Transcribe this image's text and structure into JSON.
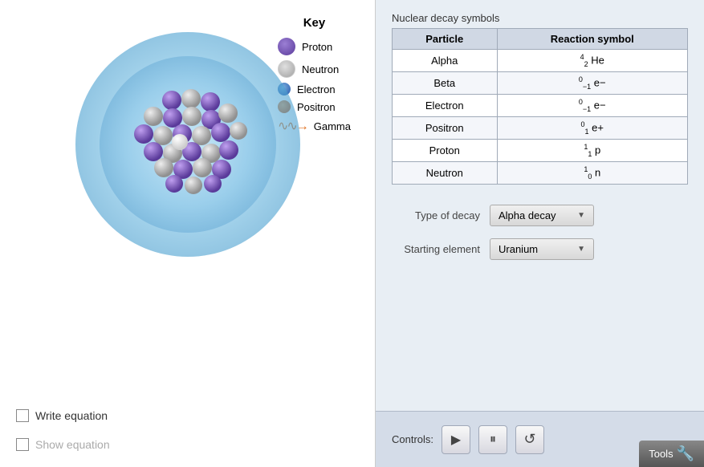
{
  "left": {
    "key": {
      "title": "Key",
      "items": [
        {
          "id": "proton",
          "label": "Proton"
        },
        {
          "id": "neutron",
          "label": "Neutron"
        },
        {
          "id": "electron",
          "label": "Electron"
        },
        {
          "id": "positron",
          "label": "Positron"
        },
        {
          "id": "gamma",
          "label": "Gamma"
        }
      ]
    },
    "checkboxes": [
      {
        "id": "write-equation",
        "label": "Write equation",
        "checked": false,
        "disabled": false
      },
      {
        "id": "show-equation",
        "label": "Show equation",
        "checked": false,
        "disabled": true
      }
    ]
  },
  "right": {
    "table_title": "Nuclear decay symbols",
    "table_headers": [
      "Particle",
      "Reaction symbol"
    ],
    "table_rows": [
      {
        "particle": "Alpha",
        "symbol_text": "He",
        "sup": "4",
        "sub": "2",
        "extra": ""
      },
      {
        "particle": "Beta",
        "symbol_text": "e−",
        "sup": "0",
        "sub": "−1",
        "extra": ""
      },
      {
        "particle": "Electron",
        "symbol_text": "e−",
        "sup": "0",
        "sub": "−1",
        "extra": ""
      },
      {
        "particle": "Positron",
        "symbol_text": "e+",
        "sup": "0",
        "sub": "1",
        "extra": ""
      },
      {
        "particle": "Proton",
        "symbol_text": "p",
        "sup": "1",
        "sub": "1",
        "extra": ""
      },
      {
        "particle": "Neutron",
        "symbol_text": "n",
        "sup": "1",
        "sub": "0",
        "extra": ""
      }
    ],
    "decay_label": "Type of decay",
    "decay_value": "Alpha decay",
    "element_label": "Starting element",
    "element_value": "Uranium"
  },
  "bottom": {
    "controls_label": "Controls:",
    "play_label": "▶",
    "pause_label": "⏸",
    "reset_label": "↺",
    "tools_label": "Tools"
  }
}
